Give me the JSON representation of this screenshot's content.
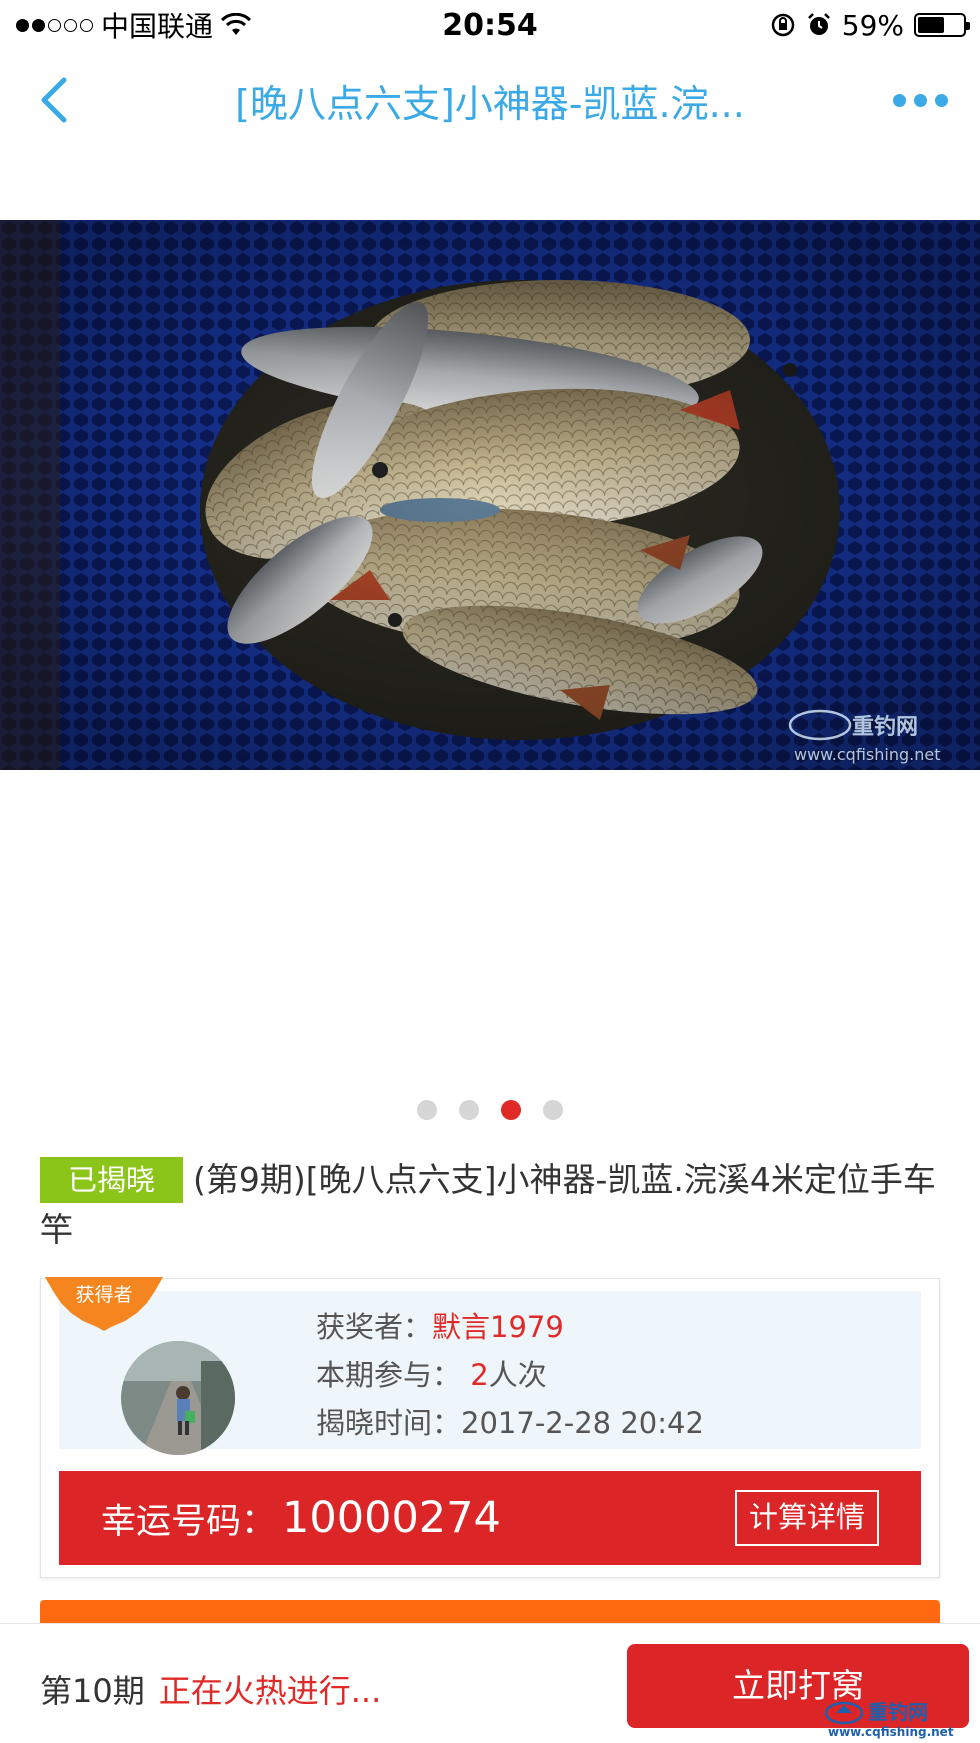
{
  "status_bar": {
    "carrier": "中国联通",
    "time": "20:54",
    "battery": "59%",
    "battery_level": 0.59
  },
  "nav": {
    "title": "[晚八点六支]小神器-凯蓝.浣..."
  },
  "carousel": {
    "watermark_brand": "重钓网",
    "watermark_url": "www.cqfishing.net",
    "page_count": 4,
    "active_index": 2
  },
  "product": {
    "badge": "已揭晓",
    "title": "(第9期)[晚八点六支]小神器-凯蓝.浣溪4米定位手车竿"
  },
  "winner": {
    "ribbon": "获得者",
    "winner_label": "获奖者：",
    "winner_name": "默言1979",
    "participate_label": "本期参与：",
    "participate_count": "2",
    "participate_unit": "人次",
    "reveal_label": "揭晓时间：",
    "reveal_time": "2017-2-28 20:42"
  },
  "lucky": {
    "label": "幸运号码：",
    "number": "10000274",
    "calc_button": "计算详情"
  },
  "bottom": {
    "period": "第10期",
    "status": "正在火热进行...",
    "join_button": "立即打窝",
    "watermark_brand": "重钓网",
    "watermark_url": "www.cqfishing.net"
  },
  "colors": {
    "accent_blue": "#3aa9e6",
    "red": "#dc2527",
    "green_badge": "#8cc51a",
    "orange": "#ff6a10"
  }
}
